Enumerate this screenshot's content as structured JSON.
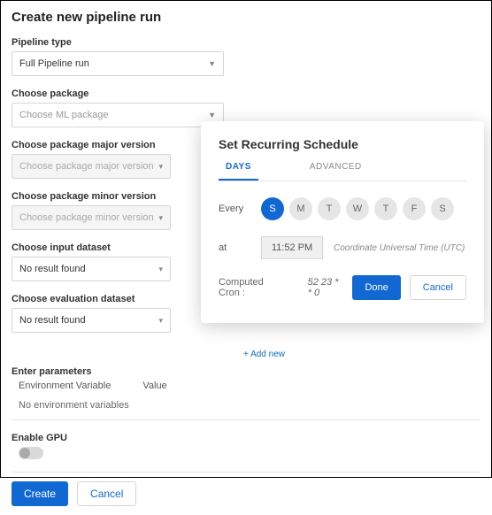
{
  "header": {
    "title": "Create new pipeline run"
  },
  "fields": {
    "pipeline_type": {
      "label": "Pipeline type",
      "value": "Full Pipeline run"
    },
    "package": {
      "label": "Choose package",
      "placeholder": "Choose ML package"
    },
    "major_version": {
      "label": "Choose package major version",
      "placeholder": "Choose package major version"
    },
    "minor_version": {
      "label": "Choose package minor version",
      "placeholder": "Choose package minor version"
    },
    "input_dataset": {
      "label": "Choose input dataset",
      "value": "No result found"
    },
    "eval_dataset": {
      "label": "Choose evaluation dataset",
      "value": "No result found"
    }
  },
  "parameters": {
    "label": "Enter parameters",
    "col1": "Environment Variable",
    "col2": "Value",
    "empty": "No environment variables",
    "add_new": "+ Add new"
  },
  "gpu": {
    "label": "Enable GPU"
  },
  "footer": {
    "create": "Create",
    "cancel": "Cancel"
  },
  "modal": {
    "title": "Set Recurring Schedule",
    "tabs": {
      "days": "DAYS",
      "advanced": "ADVANCED"
    },
    "every_label": "Every",
    "days": [
      "S",
      "M",
      "T",
      "W",
      "T",
      "F",
      "S"
    ],
    "active_day_index": 0,
    "at_label": "at",
    "time_value": "11:52 PM",
    "timezone": "Coordinate Universal Time (UTC)",
    "cron_label": "Computed Cron :",
    "cron_value": "52 23 * * 0",
    "done": "Done",
    "cancel": "Cancel"
  }
}
